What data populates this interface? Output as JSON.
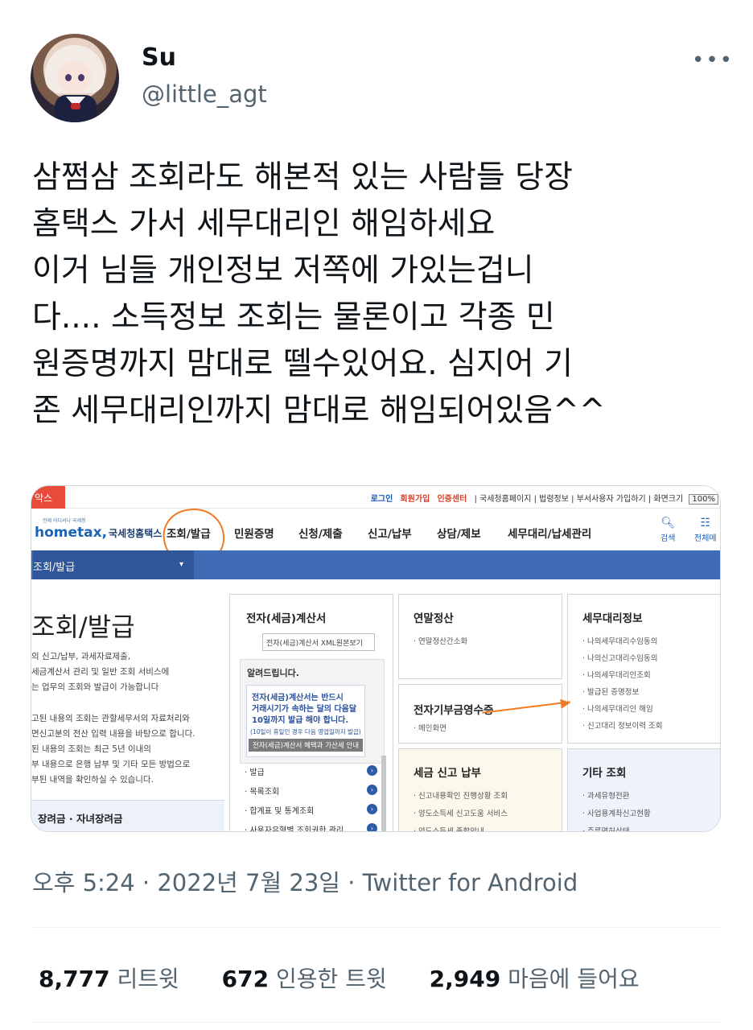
{
  "user": {
    "name": "Su",
    "handle": "@little_agt"
  },
  "more_label": "•••",
  "tweet": {
    "lines": [
      "삼쩜삼 조회라도 해본적 있는 사람들 당장",
      "홈택스 가서 세무대리인 해임하세요",
      "이거 님들 개인정보 저쪽에 가있는겁니",
      "다.... 소득정보 조회는 물론이고 각종 민",
      "원증명까지 맘대로 뗄수있어요. 심지어 기",
      "존 세무대리인까지 맘대로 해임되어있음^^"
    ]
  },
  "screenshot": {
    "red_tab": "악스",
    "top_links": {
      "login": "로그인",
      "signup": "회원가입",
      "cert": "인증센터",
      "rest": "| 국세청홈페이지 | 법령정보 | 부서사용자 가입하기 |",
      "screen_size": "화면크기",
      "zoom": "100%"
    },
    "logo": "hometax,",
    "logo_text": "국세청홈택스",
    "logo_sub": "언제 어디서나 국세청",
    "menu": [
      "조회/발급",
      "민원증명",
      "신청/제출",
      "신고/납부",
      "상담/제보",
      "세무대리/납세관리"
    ],
    "search_label": "검색",
    "all_label": "전체메",
    "breadcrumb": "조회/발급",
    "caret": "▾",
    "big_title": "조회/발급",
    "intro_lines": [
      "의 신고/납부, 과세자료제출,",
      "세금계산서 관리 및 일반 조회 서비스에",
      "는 업무의 조회와 발급이 가능합니다"
    ],
    "intro2_lines": [
      "고된 내용의 조회는 관할세무서의 자료처리와",
      "면신고분의 전산 입력 내용을 바탕으로 합니다.",
      "된 내용의 조회는 최근 5년 이내의",
      "부 내용으로 은행 납부 및 기타 모든 방법으로",
      "부된 내역을 확인하실 수 있습니다."
    ],
    "left_box": "장려금 · 자녀장려금",
    "card1": {
      "title": "전자(세금)계산서",
      "input": "전자(세금)계산서 XML원본보기",
      "notice_head": "알려드립니다.",
      "notice_l1": "전자(세금)계산서는 반드시",
      "notice_l2": "거래시기가 속하는 달의 다음달",
      "notice_l3": "10일까지 발급 해야 합니다.",
      "notice_l4": "(10일이 휴일인 경우 다음 영업일까지 발급)",
      "notice_btn": "전자(세금)계산서 혜택과 가산세 안내",
      "items": [
        "· 발급",
        "· 목록조회",
        "· 합계표 및 통계조회",
        "· 사용자유형별 조회권한 관리"
      ]
    },
    "card2": {
      "title": "연말정산",
      "items": [
        "· 연말정산간소화"
      ]
    },
    "card3": {
      "title": "전자기부금영수증",
      "items": [
        "· 메인화면"
      ]
    },
    "card4": {
      "title": "세금 신고 납부",
      "items": [
        "· 신고내용확인 진행상황 조회",
        "· 양도소득세 신고도움 서비스",
        "· 양도소득세 종합안내"
      ]
    },
    "card5": {
      "title": "세무대리정보",
      "items": [
        "· 나의세무대리수임동의",
        "· 나의신고대리수임동의",
        "· 나의세무대리인조회",
        "· 발급된 증명정보",
        "· 나의세무대리인 해임",
        "· 신고대리 정보이력 조회"
      ]
    },
    "card6": {
      "title": "기타 조회",
      "items": [
        "· 과세유형전환",
        "· 사업용계좌신고현황",
        "· 주류면허상태"
      ]
    }
  },
  "meta": "오후 5:24 · 2022년 7월 23일 · Twitter for Android",
  "stats": {
    "retweets": "8,777",
    "retweets_label": "리트윗",
    "quotes": "672",
    "quotes_label": "인용한 트윗",
    "likes": "2,949",
    "likes_label": "마음에 들어요"
  }
}
